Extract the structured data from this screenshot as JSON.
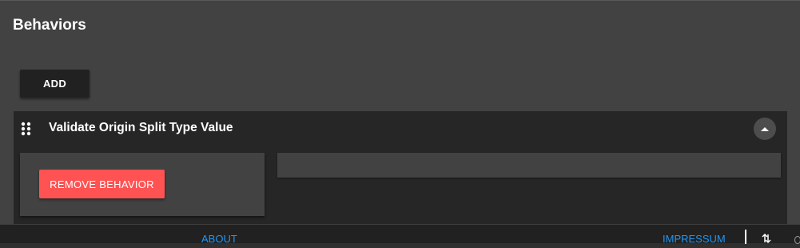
{
  "section": {
    "title": "Behaviors"
  },
  "toolbar": {
    "add_label": "ADD"
  },
  "behavior": {
    "title": "Validate Origin Split Type Value",
    "remove_label": "REMOVE BEHAVIOR",
    "field_value": ""
  },
  "footer": {
    "about_label": "ABOUT",
    "impressum_label": "IMPRESSUM"
  },
  "colors": {
    "panel": "#424242",
    "card": "#262626",
    "danger": "#ff5252",
    "link": "#2196f3",
    "footer": "#212121"
  },
  "icons": {
    "drag": "drag-handle-icon",
    "collapse": "chevron-up-icon",
    "sort": "sort-arrows-icon"
  }
}
